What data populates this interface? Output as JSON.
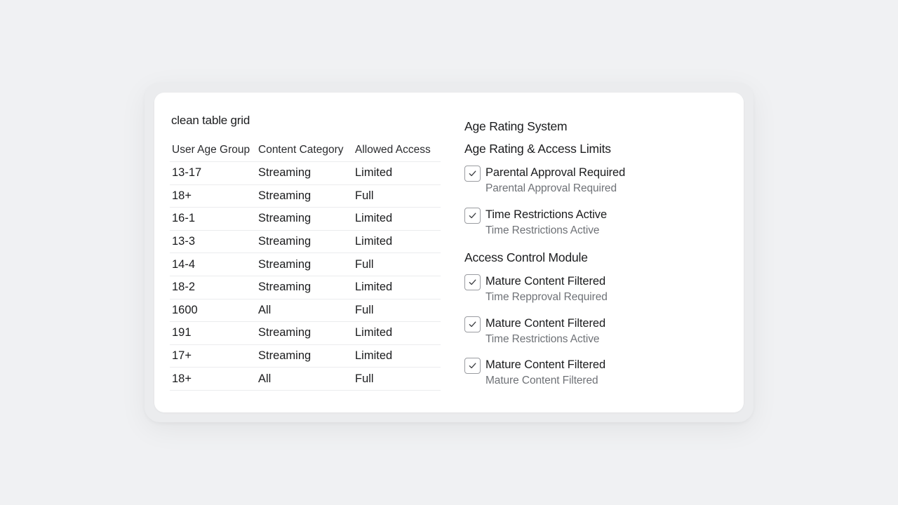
{
  "table": {
    "title": "clean table grid",
    "columns": [
      "User Age Group",
      "Content Category",
      "Allowed Access"
    ],
    "rows": [
      [
        "13-17",
        "Streaming",
        "Limited"
      ],
      [
        "18+",
        "Streaming",
        "Full"
      ],
      [
        "16-1",
        "Streaming",
        "Limited"
      ],
      [
        "13-3",
        "Streaming",
        "Limited"
      ],
      [
        "14-4",
        "Streaming",
        "Full"
      ],
      [
        "18-2",
        "Streaming",
        "Limited"
      ],
      [
        "1600",
        "All",
        "Full"
      ],
      [
        "191",
        "Streaming",
        "Limited"
      ],
      [
        "17+",
        "Streaming",
        "Limited"
      ],
      [
        "18+",
        "All",
        "Full"
      ]
    ]
  },
  "panel": {
    "system_title": "Age Rating System",
    "section1_title": "Age Rating & Access Limits",
    "section1_items": [
      {
        "label": "Parental Approval Required",
        "sub": "Parental Approval Required",
        "checked": true
      },
      {
        "label": "Time Restrictions Active",
        "sub": "Time Restrictions Active",
        "checked": true
      }
    ],
    "section2_title": "Access Control Module",
    "section2_items": [
      {
        "label": "Mature Content Filtered",
        "sub": "Time Repproval Required",
        "checked": true
      },
      {
        "label": "Mature Content Filtered",
        "sub": "Time Restrictions Active",
        "checked": true
      },
      {
        "label": "Mature Content Filtered",
        "sub": "Mature Content Filtered",
        "checked": true
      }
    ]
  },
  "icons": {
    "checkbox": "check-icon"
  }
}
